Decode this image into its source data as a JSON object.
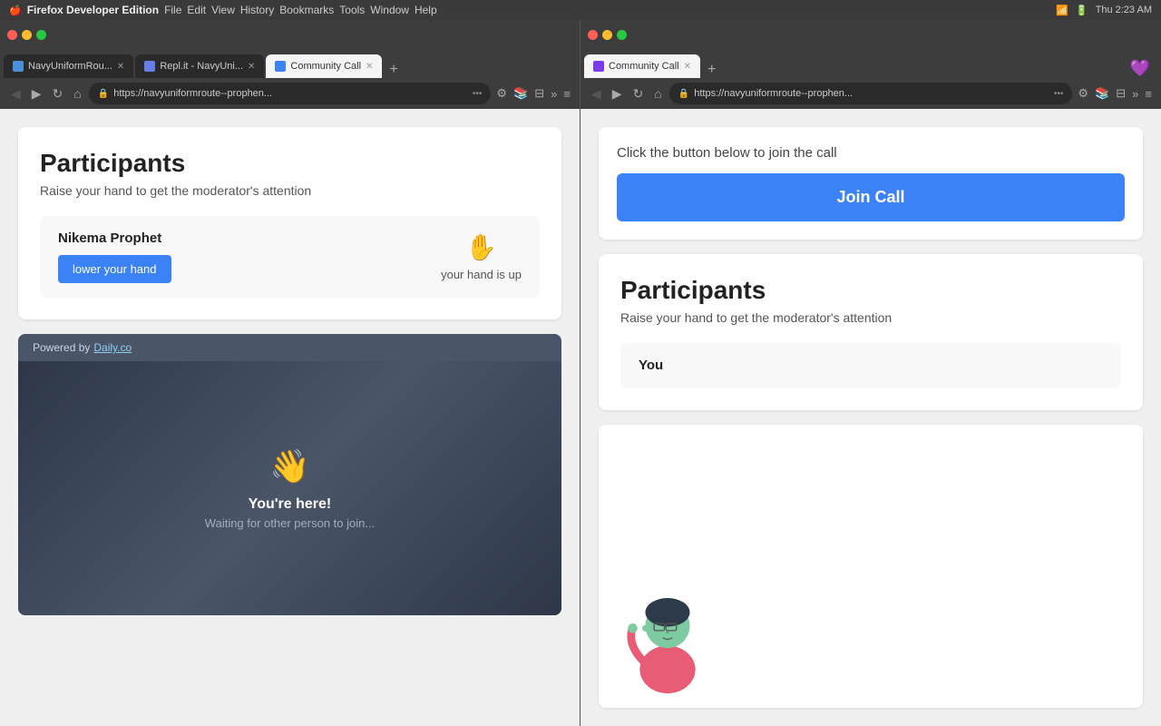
{
  "os": {
    "menu_items": [
      "Firefox Developer Edition",
      "File",
      "Edit",
      "View",
      "History",
      "Bookmarks",
      "Tools",
      "Window",
      "Help"
    ],
    "time": "Thu 2:23 AM",
    "battery": "99%"
  },
  "left_window": {
    "tabs": [
      {
        "label": "NavyUniformRou...",
        "active": false,
        "id": "tab-navy-1"
      },
      {
        "label": "Repl.it - NavyUni...",
        "active": false,
        "id": "tab-replit"
      },
      {
        "label": "Community Call",
        "active": true,
        "id": "tab-community-left"
      }
    ],
    "address": "https://navyuniformroute--prophen...",
    "participants_title": "Participants",
    "participants_subtitle": "Raise your hand to get the moderator's attention",
    "participant_name": "Nikema Prophet",
    "lower_hand_label": "lower your hand",
    "hand_status": "your hand is up",
    "daily_powered_by": "Powered by",
    "daily_link": "Daily.co",
    "daily_wave": "👋",
    "daily_main": "You're here!",
    "daily_sub": "Waiting for other person to join..."
  },
  "right_window": {
    "title": "Community Call",
    "tabs": [
      {
        "label": "Community Call",
        "active": true,
        "id": "tab-community-right"
      }
    ],
    "address": "https://navyuniformroute--prophen...",
    "join_call_text": "Click the button below to join the call",
    "join_call_label": "Join Call",
    "participants_title": "Participants",
    "participants_subtitle": "Raise your hand to get the moderator's attention",
    "you_label": "You"
  }
}
